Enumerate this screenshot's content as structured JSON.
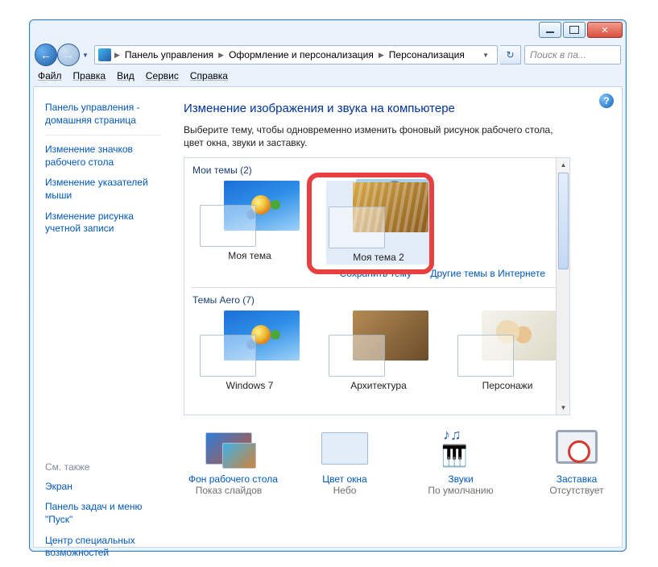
{
  "breadcrumbs": {
    "root": "Панель управления",
    "mid": "Оформление и персонализация",
    "leaf": "Персонализация"
  },
  "search_placeholder": "Поиск в па...",
  "menu": {
    "file": "Файл",
    "edit": "Правка",
    "view": "Вид",
    "service": "Сервис",
    "help": "Справка"
  },
  "sidebar": {
    "home": "Панель управления - домашняя страница",
    "links": [
      "Изменение значков рабочего стола",
      "Изменение указателей мыши",
      "Изменение рисунка учетной записи"
    ],
    "see_also_hdr": "См. также",
    "see_also": [
      "Экран",
      "Панель задач и меню \"Пуск\"",
      "Центр специальных возможностей"
    ]
  },
  "heading": "Изменение изображения и звука на компьютере",
  "description": "Выберите тему, чтобы одновременно изменить фоновый рисунок рабочего стола, цвет окна, звуки и заставку.",
  "groups": {
    "my": {
      "label": "Мои темы (2)",
      "items": [
        "Моя тема",
        "Моя тема 2"
      ],
      "save": "Сохранить тему",
      "online": "Другие темы в Интернете"
    },
    "aero": {
      "label": "Темы Aero (7)",
      "items": [
        "Windows 7",
        "Архитектура",
        "Персонажи"
      ]
    }
  },
  "bottom": {
    "wallpaper": {
      "title": "Фон рабочего стола",
      "sub": "Показ слайдов"
    },
    "color": {
      "title": "Цвет окна",
      "sub": "Небо"
    },
    "sounds": {
      "title": "Звуки",
      "sub": "По умолчанию"
    },
    "saver": {
      "title": "Заставка",
      "sub": "Отсутствует"
    }
  }
}
